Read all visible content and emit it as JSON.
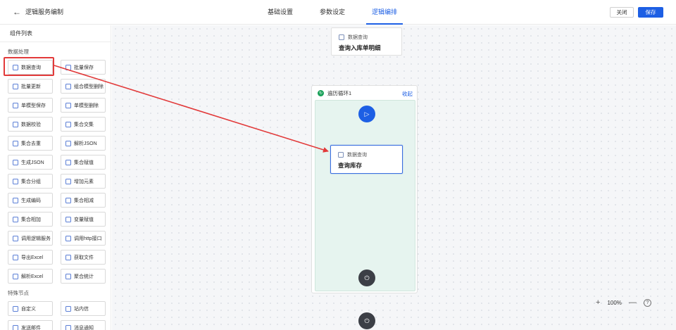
{
  "header": {
    "back_label": "逻辑服务编制",
    "tabs": [
      "基础设置",
      "参数设定",
      "逻辑编排"
    ],
    "active_tab": 2,
    "close_label": "关闭",
    "save_label": "保存",
    "accent_color": "#1d5fe4"
  },
  "sidebar": {
    "title": "组件列表",
    "sections": [
      {
        "title": "数据处理",
        "items": [
          "数据查询",
          "批量保存",
          "批量更新",
          "组合模型删除",
          "单模型保存",
          "单模型删除",
          "数据校验",
          "集合交集",
          "集合去重",
          "解析JSON",
          "生成JSON",
          "集合赋值",
          "集合分组",
          "增加元素",
          "生成编码",
          "集合相减",
          "集合相加",
          "变量赋值",
          "调用逻辑服务",
          "调用http接口",
          "导出Excel",
          "获取文件",
          "解析Excel",
          "聚合统计"
        ]
      },
      {
        "title": "特殊节点",
        "items": [
          "自定义",
          "站内信",
          "发送邮件",
          "消息通知"
        ]
      }
    ]
  },
  "canvas": {
    "top_node": {
      "type": "数据查询",
      "name": "查询入库单明细"
    },
    "loop": {
      "title": "遍历循环1",
      "collapse_label": "收起",
      "inner_node": {
        "type": "数据查询",
        "name": "查询库存"
      }
    },
    "zoom": {
      "level": "100%",
      "plus": "+",
      "minus": "—",
      "help": "?"
    }
  },
  "annotation_color": "#e23a3a"
}
